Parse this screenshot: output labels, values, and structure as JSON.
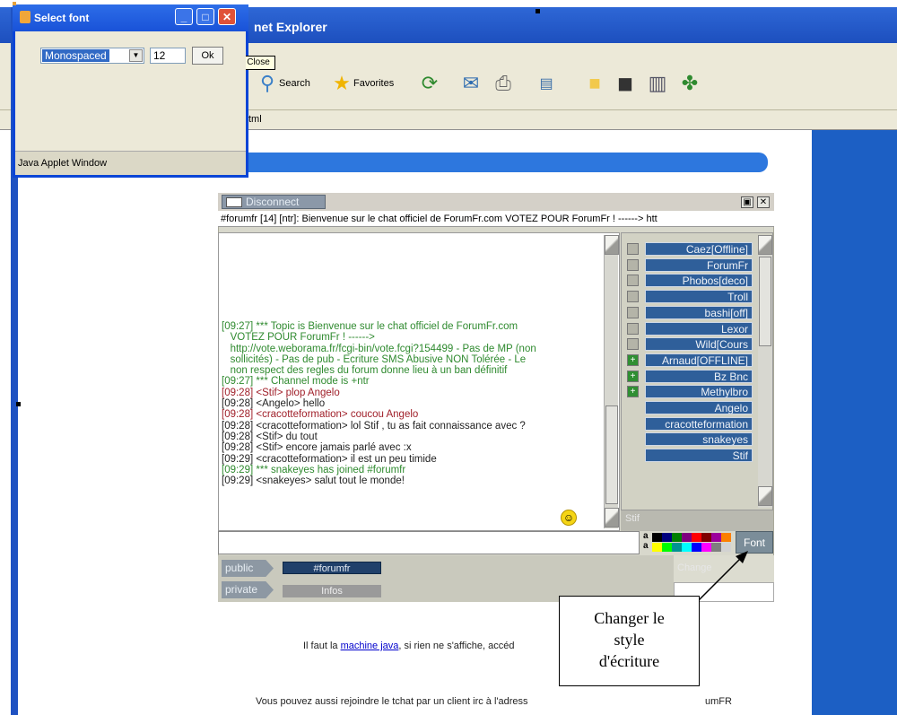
{
  "browser": {
    "title": "net Explorer",
    "address_tail": "tml",
    "toolbar": {
      "search_label": "Search",
      "favorites_label": "Favorites"
    }
  },
  "chat": {
    "disconnect_label": "Disconnect",
    "topic_line": "#forumfr [14] [ntr]: Bienvenue sur le chat officiel de ForumFr.com VOTEZ POUR ForumFr ! ------> htt",
    "messages": [
      {
        "text": "[09:27] *** Topic is Bienvenue sur le chat officiel de ForumFr.com\n   VOTEZ POUR ForumFr ! ------>\n   http://vote.weborama.fr/fcgi-bin/vote.fcgi?154499 - Pas de MP (non\n   sollicités) - Pas de pub - Ecriture SMS Abusive NON Tolérée - Le\n   non respect des regles du forum donne lieu à un ban définitif",
        "color": "green"
      },
      {
        "text": "[09:27] *** Channel mode is +ntr",
        "color": "green"
      },
      {
        "text": "[09:28] <Stif> plop Angelo",
        "color": "red"
      },
      {
        "text": "[09:28] <Angelo> hello",
        "color": "black"
      },
      {
        "text": "[09:28] <cracotteformation> coucou Angelo",
        "color": "red"
      },
      {
        "text": "[09:28] <cracotteformation> lol Stif , tu as fait connaissance avec ?",
        "color": "black"
      },
      {
        "text": "[09:28] <Stif> du tout",
        "color": "black"
      },
      {
        "text": "[09:28] <Stif> encore jamais parlé avec :x",
        "color": "black"
      },
      {
        "text": "[09:29] <cracotteformation> il est un peu timide",
        "color": "black"
      },
      {
        "text": "[09:29] *** snakeyes has joined #forumfr",
        "color": "green"
      },
      {
        "text": "[09:29] <snakeyes> salut tout le monde!",
        "color": "black"
      }
    ],
    "users": [
      {
        "name": "Caez[Offline]",
        "mark": "",
        "op": false
      },
      {
        "name": "ForumFr",
        "mark": "",
        "op": false
      },
      {
        "name": "Phobos[deco]",
        "mark": "",
        "op": false
      },
      {
        "name": "Troll",
        "mark": "",
        "op": false
      },
      {
        "name": "bashi[off]",
        "mark": "",
        "op": false
      },
      {
        "name": "Lexor",
        "mark": "",
        "op": false
      },
      {
        "name": "Wild[Cours",
        "mark": "",
        "op": false
      },
      {
        "name": "Arnaud[OFFLINE]",
        "mark": "+",
        "op": true
      },
      {
        "name": "Bz Bnc",
        "mark": "+",
        "op": true
      },
      {
        "name": "Methylbro",
        "mark": "+",
        "op": true
      },
      {
        "name": "Angelo",
        "mark": "",
        "op": false
      },
      {
        "name": "cracotteformation",
        "mark": "",
        "op": false
      },
      {
        "name": "snakeyes",
        "mark": "",
        "op": false
      },
      {
        "name": "Stif",
        "mark": "",
        "op": false
      }
    ],
    "users_status": "Stif",
    "color_label_1": "a",
    "color_label_2": "a",
    "font_button_label": "Font",
    "tabs": [
      {
        "label": "public",
        "channel": "#forumfr",
        "selected": true
      },
      {
        "label": "private",
        "channel": "Infos",
        "selected": false
      }
    ],
    "change_label": "Change"
  },
  "page": {
    "footer_line1_prefix": "Il faut la ",
    "footer_line1_link": "machine java",
    "footer_line1_suffix": ", si rien ne s'affiche, accéd",
    "footer_line2": "Vous pouvez aussi rejoindre le tchat par un client irc à l'adress",
    "footer_line2_tail": "umFR"
  },
  "callout": {
    "line1": "Changer le",
    "line2": "style",
    "line3": "d'écriture"
  },
  "select_font_window": {
    "title": "Select font",
    "font_value": "Monospaced",
    "size_value": "12",
    "ok_label": "Ok",
    "status": "Java Applet Window",
    "tooltip": "Close"
  },
  "colors": {
    "xp_blue": "#0a45d6",
    "user_row": "#2f5f9a",
    "page_blue": "#1c5fc4"
  }
}
